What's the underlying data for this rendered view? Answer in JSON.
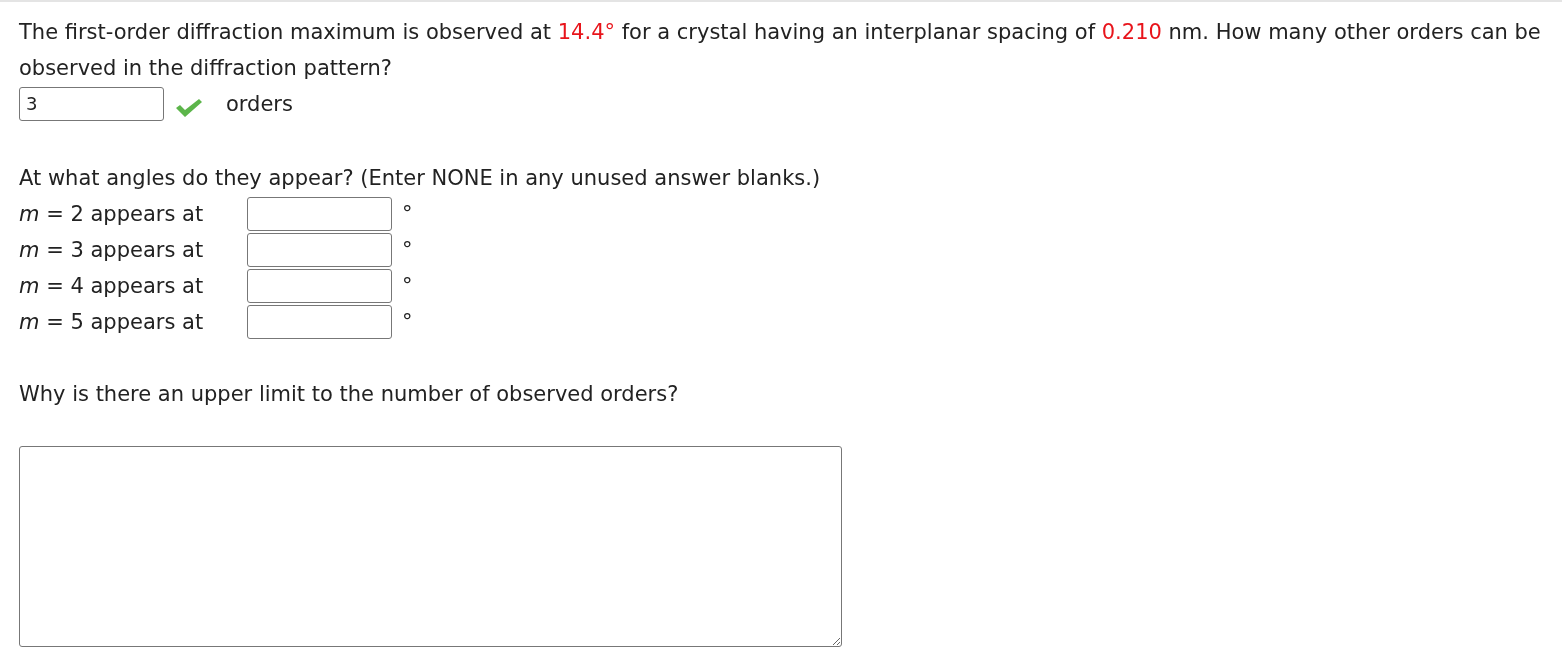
{
  "question": {
    "parts": [
      {
        "text": "The first-order diffraction maximum is observed at ",
        "highlight": false
      },
      {
        "text": "14.4°",
        "highlight": true
      },
      {
        "text": " for a crystal having an interplanar spacing of ",
        "highlight": false
      },
      {
        "text": "0.210",
        "highlight": true
      },
      {
        "text": " nm. How many other orders can be observed in the diffraction pattern?",
        "highlight": false
      }
    ]
  },
  "orders_answer": {
    "value": "3",
    "correct": true,
    "unit": "orders"
  },
  "angles_prompt": "At what angles do they appear? (Enter NONE in any unused answer blanks.)",
  "angle_rows": [
    {
      "label": "*m* = 2 appears at",
      "unit": "°"
    },
    {
      "label": "*m* = 3 appears at",
      "unit": "°"
    },
    {
      "label": "*m* = 4 appears at",
      "unit": "°"
    },
    {
      "label": "*m* = 5 appears at",
      "unit": "°"
    }
  ],
  "limit_prompt": "Why is there an upper limit to the number of observed orders?"
}
